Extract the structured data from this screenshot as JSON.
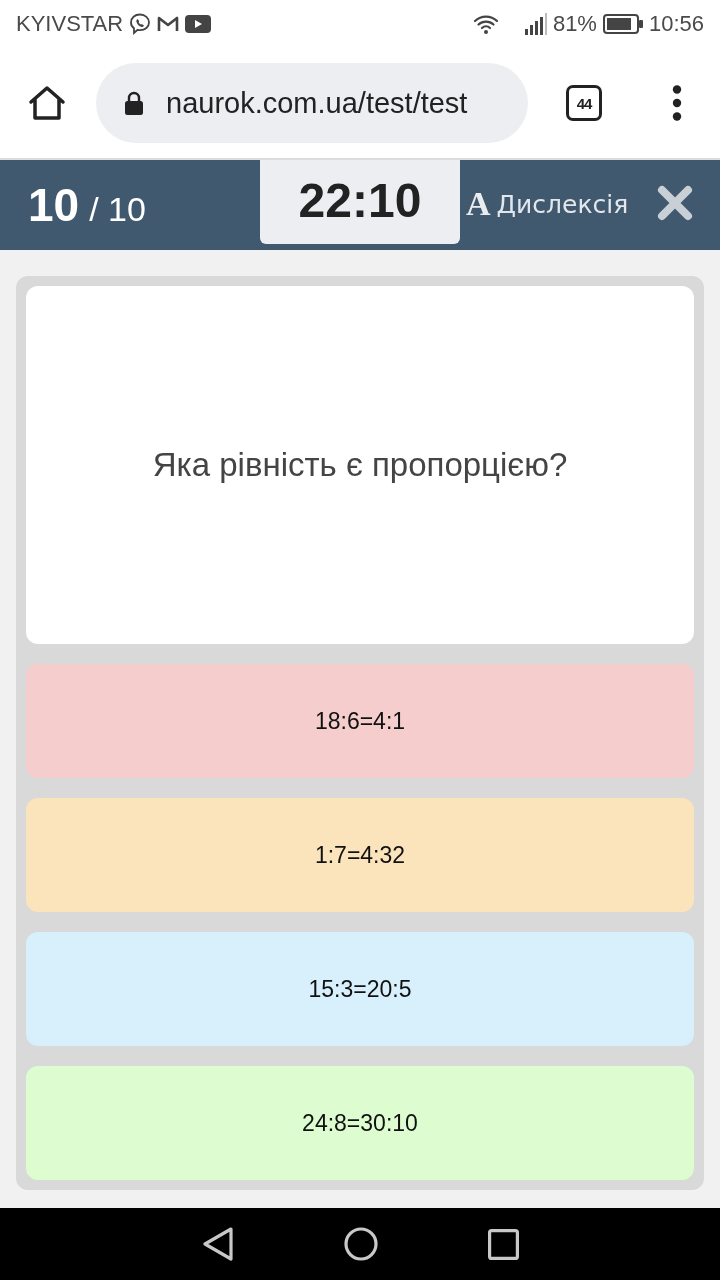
{
  "status_bar": {
    "carrier": "KYIVSTAR",
    "battery": "81%",
    "time": "10:56"
  },
  "browser": {
    "url": "naurok.com.ua/test/test",
    "tab_count": "44"
  },
  "quiz_header": {
    "current": "10",
    "total": "/ 10",
    "timer": "22:10",
    "dyslexia_letter": "A",
    "dyslexia_label": "Дислексія"
  },
  "question": {
    "text": "Яка рівність є пропорцією?"
  },
  "answers": [
    {
      "text": "18:6=4:1",
      "color": "#f6cdcd"
    },
    {
      "text": "1:7=4:32",
      "color": "#fbe3bc"
    },
    {
      "text": "15:3=20:5",
      "color": "#d8f0fb"
    },
    {
      "text": "24:8=30:10",
      "color": "#ddfdd0"
    }
  ]
}
